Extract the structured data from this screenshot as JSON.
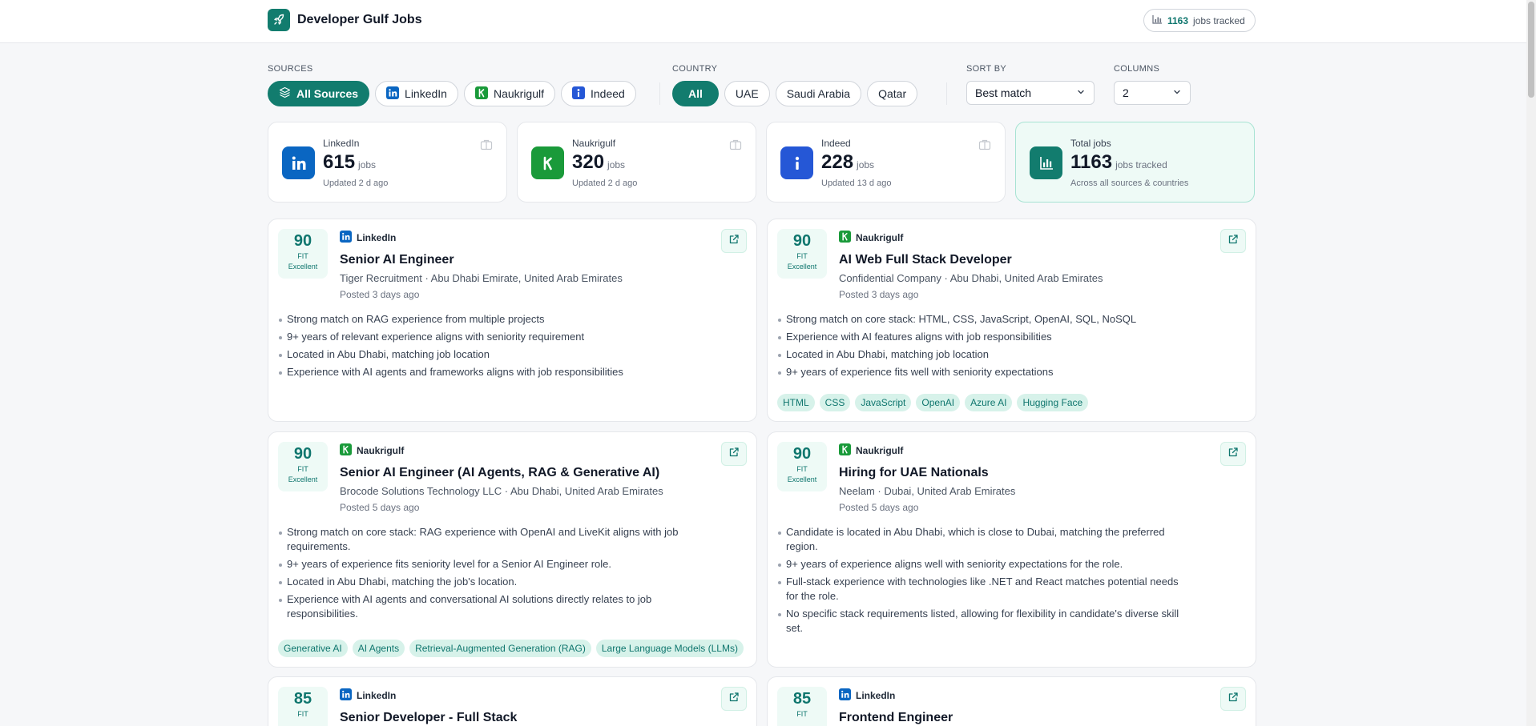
{
  "app": {
    "title": "Developer Gulf Jobs",
    "tracked_count": "1163",
    "tracked_label": "jobs tracked"
  },
  "filters": {
    "sources_label": "SOURCES",
    "sources": [
      "All Sources",
      "LinkedIn",
      "Naukrigulf",
      "Indeed"
    ],
    "country_label": "COUNTRY",
    "countries": [
      "All",
      "UAE",
      "Saudi Arabia",
      "Qatar"
    ],
    "sort_label": "SORT BY",
    "sort_value": "Best match",
    "columns_label": "COLUMNS",
    "columns_value": "2"
  },
  "stats": [
    {
      "name": "LinkedIn",
      "count": "615",
      "unit": "jobs",
      "updated": "Updated 2 d ago"
    },
    {
      "name": "Naukrigulf",
      "count": "320",
      "unit": "jobs",
      "updated": "Updated 2 d ago"
    },
    {
      "name": "Indeed",
      "count": "228",
      "unit": "jobs",
      "updated": "Updated 13 d ago"
    },
    {
      "name": "Total jobs",
      "count": "1163",
      "unit": "jobs tracked",
      "updated": "Across all sources & countries"
    }
  ],
  "jobs": [
    {
      "score": "90",
      "fit_label": "FIT",
      "rating": "Excellent",
      "source": "LinkedIn",
      "title": "Senior AI Engineer",
      "company": "Tiger Recruitment · Abu Dhabi Emirate, United Arab Emirates",
      "posted": "Posted 3 days ago",
      "bullets": [
        "Strong match on RAG experience from multiple projects",
        "9+ years of relevant experience aligns with seniority requirement",
        "Located in Abu Dhabi, matching job location",
        "Experience with AI agents and frameworks aligns with job responsibilities"
      ],
      "tags": []
    },
    {
      "score": "90",
      "fit_label": "FIT",
      "rating": "Excellent",
      "source": "Naukrigulf",
      "title": "AI Web Full Stack Developer",
      "company": "Confidential Company · Abu Dhabi, United Arab Emirates",
      "posted": "Posted 3 days ago",
      "bullets": [
        "Strong match on core stack: HTML, CSS, JavaScript, OpenAI, SQL, NoSQL",
        "Experience with AI features aligns with job responsibilities",
        "Located in Abu Dhabi, matching job location",
        "9+ years of experience fits well with seniority expectations"
      ],
      "tags": [
        "HTML",
        "CSS",
        "JavaScript",
        "OpenAI",
        "Azure AI",
        "Hugging Face"
      ]
    },
    {
      "score": "90",
      "fit_label": "FIT",
      "rating": "Excellent",
      "source": "Naukrigulf",
      "title": "Senior AI Engineer (AI Agents, RAG & Generative AI)",
      "company": "Brocode Solutions Technology LLC · Abu Dhabi, United Arab Emirates",
      "posted": "Posted 5 days ago",
      "bullets": [
        "Strong match on core stack: RAG experience with OpenAI and LiveKit aligns with job requirements.",
        "9+ years of experience fits seniority level for a Senior AI Engineer role.",
        "Located in Abu Dhabi, matching the job's location.",
        "Experience with AI agents and conversational AI solutions directly relates to job responsibilities."
      ],
      "tags": [
        "Generative AI",
        "AI Agents",
        "Retrieval-Augmented Generation (RAG)",
        "Large Language Models (LLMs)"
      ]
    },
    {
      "score": "90",
      "fit_label": "FIT",
      "rating": "Excellent",
      "source": "Naukrigulf",
      "title": "Hiring for UAE Nationals",
      "company": "Neelam · Dubai, United Arab Emirates",
      "posted": "Posted 5 days ago",
      "bullets": [
        "Candidate is located in Abu Dhabi, which is close to Dubai, matching the preferred region.",
        "9+ years of experience aligns well with seniority expectations for the role.",
        "Full-stack experience with technologies like .NET and React matches potential needs for the role.",
        "No specific stack requirements listed, allowing for flexibility in candidate's diverse skill set."
      ],
      "tags": []
    },
    {
      "score": "85",
      "fit_label": "FIT",
      "rating": "",
      "source": "LinkedIn",
      "title": "Senior Developer - Full Stack",
      "company": "",
      "posted": "",
      "bullets": [],
      "tags": []
    },
    {
      "score": "85",
      "fit_label": "FIT",
      "rating": "",
      "source": "LinkedIn",
      "title": "Frontend Engineer",
      "company": "",
      "posted": "",
      "bullets": [],
      "tags": []
    }
  ],
  "colors": {
    "accent": "#127c6e",
    "linkedin": "#0a66c2",
    "naukrigulf": "#1a9a3a",
    "indeed": "#2557d6"
  },
  "icons": {
    "brand": "rocket-icon",
    "chart": "bar-chart-icon",
    "external": "external-link-icon",
    "bag": "briefcase-icon",
    "layers": "layers-icon",
    "chevron": "chevron-down-icon"
  }
}
